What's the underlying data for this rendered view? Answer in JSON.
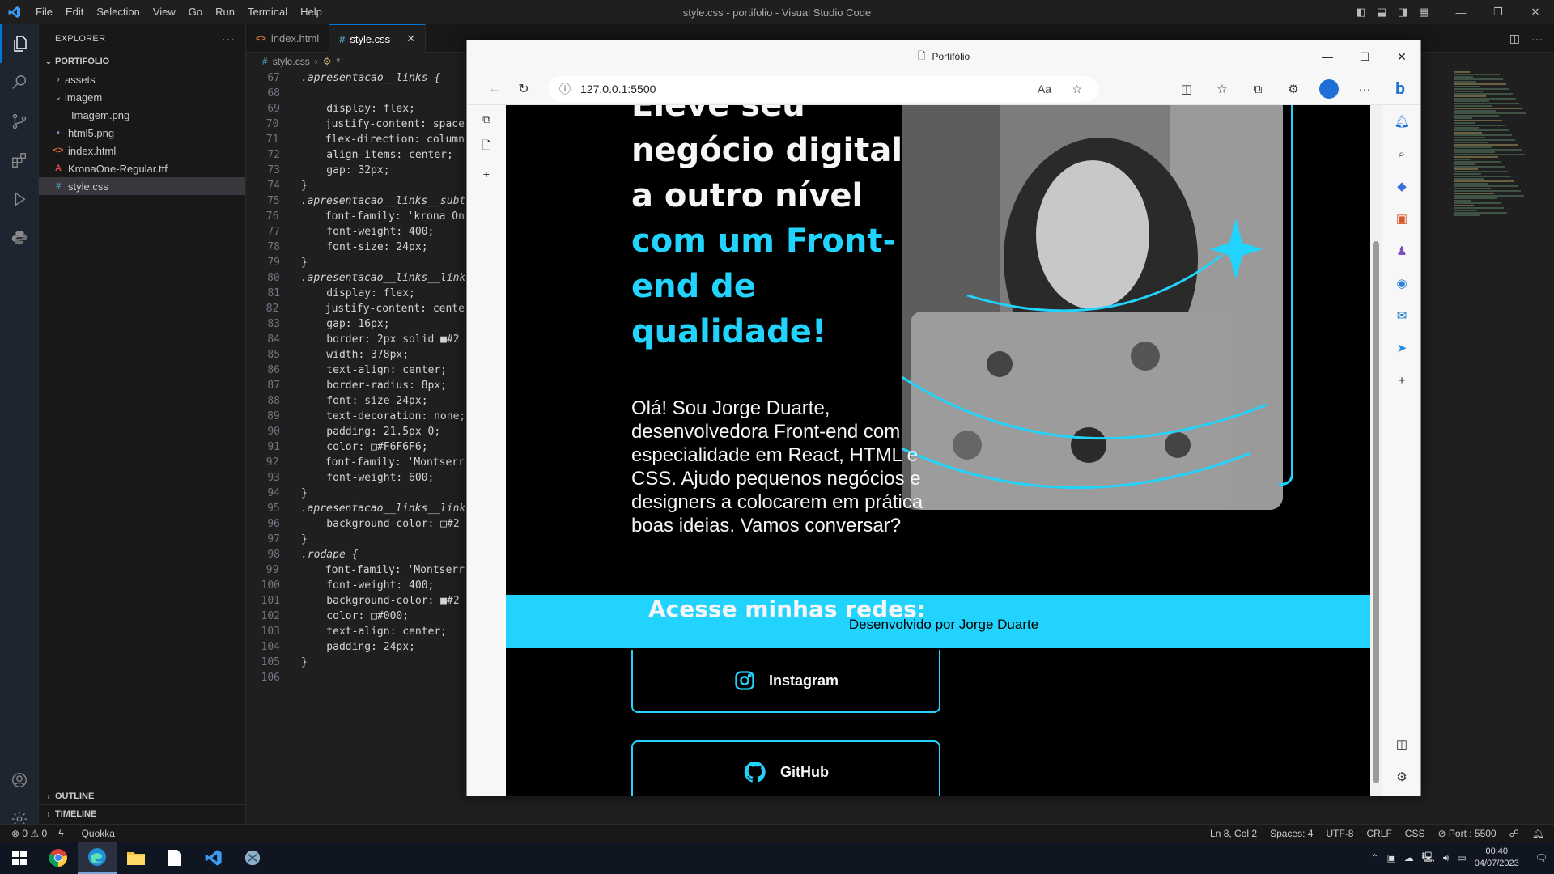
{
  "window_title": "style.css - portifolio - Visual Studio Code",
  "menu": [
    "File",
    "Edit",
    "Selection",
    "View",
    "Go",
    "Run",
    "Terminal",
    "Help"
  ],
  "explorer": {
    "title": "EXPLORER",
    "root": "PORTIFOLIO",
    "items": [
      {
        "label": "assets",
        "kind": "folder-collapsed"
      },
      {
        "label": "imagem",
        "kind": "folder-open"
      },
      {
        "label": "Imagem.png",
        "kind": "image"
      },
      {
        "label": "html5.png",
        "kind": "image"
      },
      {
        "label": "index.html",
        "kind": "html"
      },
      {
        "label": "KronaOne-Regular.ttf",
        "kind": "font"
      },
      {
        "label": "style.css",
        "kind": "css"
      }
    ],
    "outline": "OUTLINE",
    "timeline": "TIMELINE"
  },
  "tabs": [
    {
      "label": "index.html",
      "icon": "<>"
    },
    {
      "label": "style.css",
      "icon": "#"
    }
  ],
  "breadcrumb": {
    "file": "style.css",
    "symbol": "*"
  },
  "code_lines": [
    {
      "n": "67",
      "t": ".apresentacao__links {"
    },
    {
      "n": "68",
      "t": ""
    },
    {
      "n": "69",
      "t": "    display: flex;"
    },
    {
      "n": "70",
      "t": "    justify-content: space-"
    },
    {
      "n": "71",
      "t": "    flex-direction: column;"
    },
    {
      "n": "72",
      "t": "    align-items: center;"
    },
    {
      "n": "73",
      "t": "    gap: 32px;"
    },
    {
      "n": "74",
      "t": "}"
    },
    {
      "n": "75",
      "t": ".apresentacao__links__subt"
    },
    {
      "n": "76",
      "t": "    font-family: 'krona One"
    },
    {
      "n": "77",
      "t": "    font-weight: 400;"
    },
    {
      "n": "78",
      "t": "    font-size: 24px;"
    },
    {
      "n": "79",
      "t": "}"
    },
    {
      "n": "80",
      "t": ".apresentacao__links__link"
    },
    {
      "n": "81",
      "t": "    display: flex;"
    },
    {
      "n": "82",
      "t": "    justify-content: center"
    },
    {
      "n": "83",
      "t": "    gap: 16px;"
    },
    {
      "n": "84",
      "t": "    border: 2px solid ■#2"
    },
    {
      "n": "85",
      "t": "    width: 378px;"
    },
    {
      "n": "86",
      "t": "    text-align: center;"
    },
    {
      "n": "87",
      "t": "    border-radius: 8px;"
    },
    {
      "n": "88",
      "t": "    font: size 24px;"
    },
    {
      "n": "89",
      "t": "    text-decoration: none;"
    },
    {
      "n": "90",
      "t": "    padding: 21.5px 0;"
    },
    {
      "n": "91",
      "t": "    color: □#F6F6F6;"
    },
    {
      "n": "92",
      "t": "    font-family: 'Montserra"
    },
    {
      "n": "93",
      "t": "    font-weight: 600;"
    },
    {
      "n": "94",
      "t": "}"
    },
    {
      "n": "95",
      "t": ".apresentacao__links__link"
    },
    {
      "n": "96",
      "t": "    background-color: □#2"
    },
    {
      "n": "97",
      "t": "}"
    },
    {
      "n": "98",
      "t": ".rodape {"
    },
    {
      "n": "99",
      "t": "    font-family: 'Montserra"
    },
    {
      "n": "100",
      "t": "    font-weight: 400;"
    },
    {
      "n": "101",
      "t": "    background-color: ■#2"
    },
    {
      "n": "102",
      "t": "    color: □#000;"
    },
    {
      "n": "103",
      "t": "    text-align: center;"
    },
    {
      "n": "104",
      "t": "    padding: 24px;"
    },
    {
      "n": "105",
      "t": "}"
    },
    {
      "n": "106",
      "t": ""
    }
  ],
  "browser": {
    "tab_title": "Portifólio",
    "url": "127.0.0.1:5500",
    "page": {
      "hero_line1": "Eleve seu",
      "hero_line2": "negócio digital",
      "hero_line3": "a outro nível",
      "hero_accent1": " com um Front-",
      "hero_accent2": "end de",
      "hero_accent3": "qualidade!",
      "intro": "Olá! Sou Jorge Duarte, desenvolvedora Front-end com especialidade em React, HTML e CSS. Ajudo pequenos negócios e designers a colocarem em prática boas ideias. Vamos conversar?",
      "redes_title": "Acesse minhas redes:",
      "footer": "Desenvolvido por Jorge Duarte",
      "links": [
        {
          "label": "Instagram",
          "icon": "instagram-icon"
        },
        {
          "label": "GitHub",
          "icon": "github-icon"
        }
      ]
    }
  },
  "status": {
    "errors": "0",
    "warnings": "0",
    "quokka": "Quokka",
    "cursor": "Ln 8, Col 2",
    "spaces": "Spaces: 4",
    "encoding": "UTF-8",
    "eol": "CRLF",
    "lang": "CSS",
    "port": "Port : 5500"
  },
  "taskbar": {
    "time": "00:40",
    "date": "04/07/2023"
  },
  "colors": {
    "accent": "#22d4fd",
    "page_bg": "#000000",
    "text_light": "#F6F6F6",
    "vscode_blue": "#0078d4"
  }
}
